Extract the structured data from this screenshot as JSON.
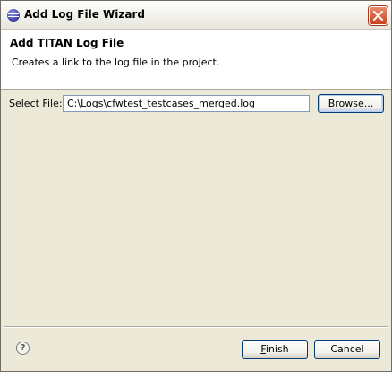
{
  "window": {
    "title": "Add Log File Wizard",
    "close_label": "×"
  },
  "header": {
    "title": "Add TITAN Log File",
    "description": "Creates a link to the log file in the project."
  },
  "form": {
    "select_file_label": "Select File:",
    "select_file_value": "C:\\Logs\\cfwtest_testcases_merged.log",
    "browse_label_underlined": "B",
    "browse_label_rest": "rowse..."
  },
  "footer": {
    "help_icon_glyph": "?",
    "finish_label_underlined": "F",
    "finish_label_rest": "inish",
    "cancel_label": "Cancel"
  },
  "icons": {
    "app": "eclipse-icon",
    "close": "close-icon",
    "help": "help-icon"
  },
  "colors": {
    "dialog_bg": "#ece9d8",
    "header_bg": "#ffffff",
    "close_button": "#c9411f",
    "input_border": "#7f9db9",
    "button_border": "#003c74"
  }
}
